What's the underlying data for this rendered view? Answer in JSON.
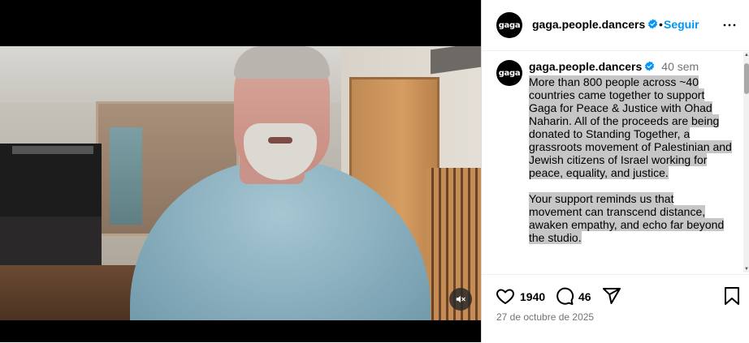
{
  "account": {
    "avatar_text": "gaga",
    "username": "gaga.people.dancers",
    "follow_label": "Seguir",
    "separator": "•"
  },
  "post": {
    "time_ago": "40 sem",
    "caption_lines_p1": [
      "More than 800 people across ~40",
      "countries came together to support",
      "Gaga for Peace & Justice with Ohad",
      "Naharin. All of the proceeds are being",
      "donated to Standing Together, a",
      "grassroots movement of Palestinian and",
      "Jewish citizens of Israel working for",
      "peace, equality, and justice."
    ],
    "caption_lines_p2": [
      "Your support reminds us that",
      "movement can transcend distance,",
      "awaken empathy, and echo far beyond",
      "the studio."
    ],
    "likes": "1940",
    "comments": "46",
    "date": "27 de octubre de 2025"
  },
  "icons": {
    "verified": "verified-badge-icon",
    "more": "more-options-icon",
    "mute": "muted-speaker-icon",
    "like": "heart-icon",
    "comment": "comment-bubble-icon",
    "share": "paper-plane-icon",
    "save": "bookmark-icon"
  },
  "colors": {
    "accent": "#0095f6",
    "verified": "#0095f6",
    "selection": "#c6c6c6",
    "muted_text": "#737373"
  }
}
